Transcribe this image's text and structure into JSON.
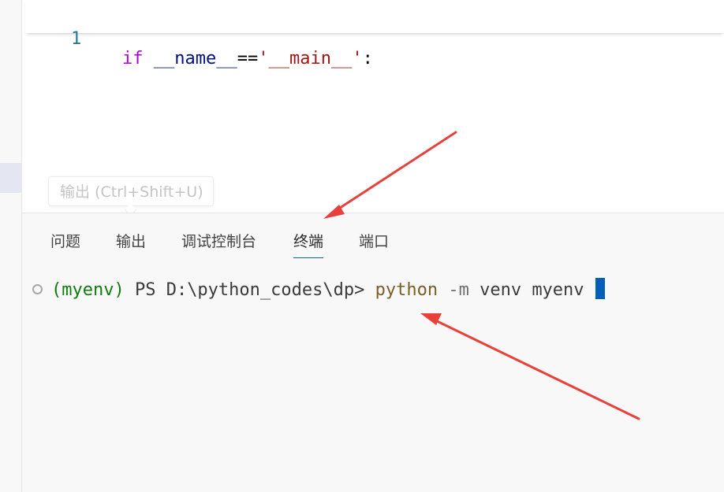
{
  "editor": {
    "line_number": "1",
    "code_tokens": [
      {
        "text": "if",
        "kind": "kw"
      },
      {
        "text": " ",
        "kind": "op"
      },
      {
        "text": "__name__",
        "kind": "id"
      },
      {
        "text": "==",
        "kind": "op"
      },
      {
        "text": "'__main__'",
        "kind": "str"
      },
      {
        "text": ":",
        "kind": "op"
      }
    ]
  },
  "tooltip": {
    "text": "输出 (Ctrl+Shift+U)"
  },
  "panel": {
    "tabs": [
      {
        "label": "问题"
      },
      {
        "label": "输出"
      },
      {
        "label": "调试控制台"
      },
      {
        "label": "终端",
        "active": true
      },
      {
        "label": "端口"
      }
    ]
  },
  "terminal": {
    "env": "(myenv)",
    "prompt": " PS D:\\python_codes\\dp> ",
    "command": "python",
    "flag": " -m",
    "args": " venv myenv"
  },
  "colors": {
    "accent": "#005fb8",
    "annotation_arrow": "#e8413c",
    "env_green": "#107c10",
    "command_yellow": "#795e26"
  }
}
